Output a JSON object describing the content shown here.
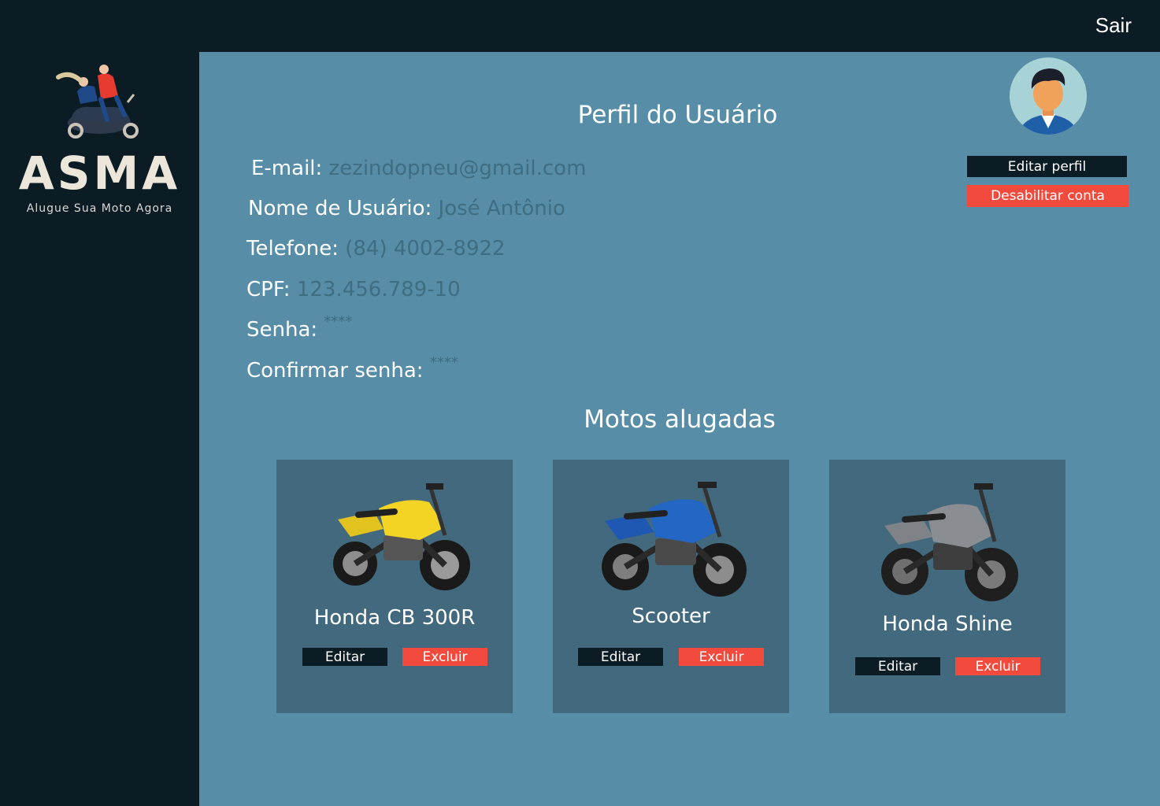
{
  "header": {
    "logout_label": "Sair"
  },
  "brand": {
    "name": "ASMA",
    "tagline": "Alugue Sua Moto Agora"
  },
  "profile": {
    "title": "Perfil do Usuário",
    "edit_label": "Editar perfil",
    "disable_label": "Desabilitar conta",
    "fields": [
      {
        "label": "E-mail:",
        "value": "zezindopneu@gmail.com"
      },
      {
        "label": "Nome de Usuário:",
        "value": "José Antônio"
      },
      {
        "label": "Telefone:",
        "value": "(84) 4002-8922"
      },
      {
        "label": "CPF:",
        "value": "123.456.789-10"
      },
      {
        "label": "Senha:",
        "value": "****"
      },
      {
        "label": "Confirmar senha:",
        "value": "****"
      }
    ]
  },
  "rentals": {
    "title": "Motos alugadas",
    "items": [
      {
        "name": "Honda CB 300R",
        "edit_label": "Editar",
        "delete_label": "Excluir",
        "color": "#f3d324"
      },
      {
        "name": "Scooter",
        "edit_label": "Editar",
        "delete_label": "Excluir",
        "color": "#2466c4"
      },
      {
        "name": "Honda Shine",
        "edit_label": "Editar",
        "delete_label": "Excluir",
        "color": "#8a8d92"
      }
    ]
  },
  "colors": {
    "dark": "#0c1c25",
    "main_bg": "#578da6",
    "card_bg": "#42697d",
    "accent_red": "#f24a3d",
    "value_text": "#3f6d82"
  }
}
